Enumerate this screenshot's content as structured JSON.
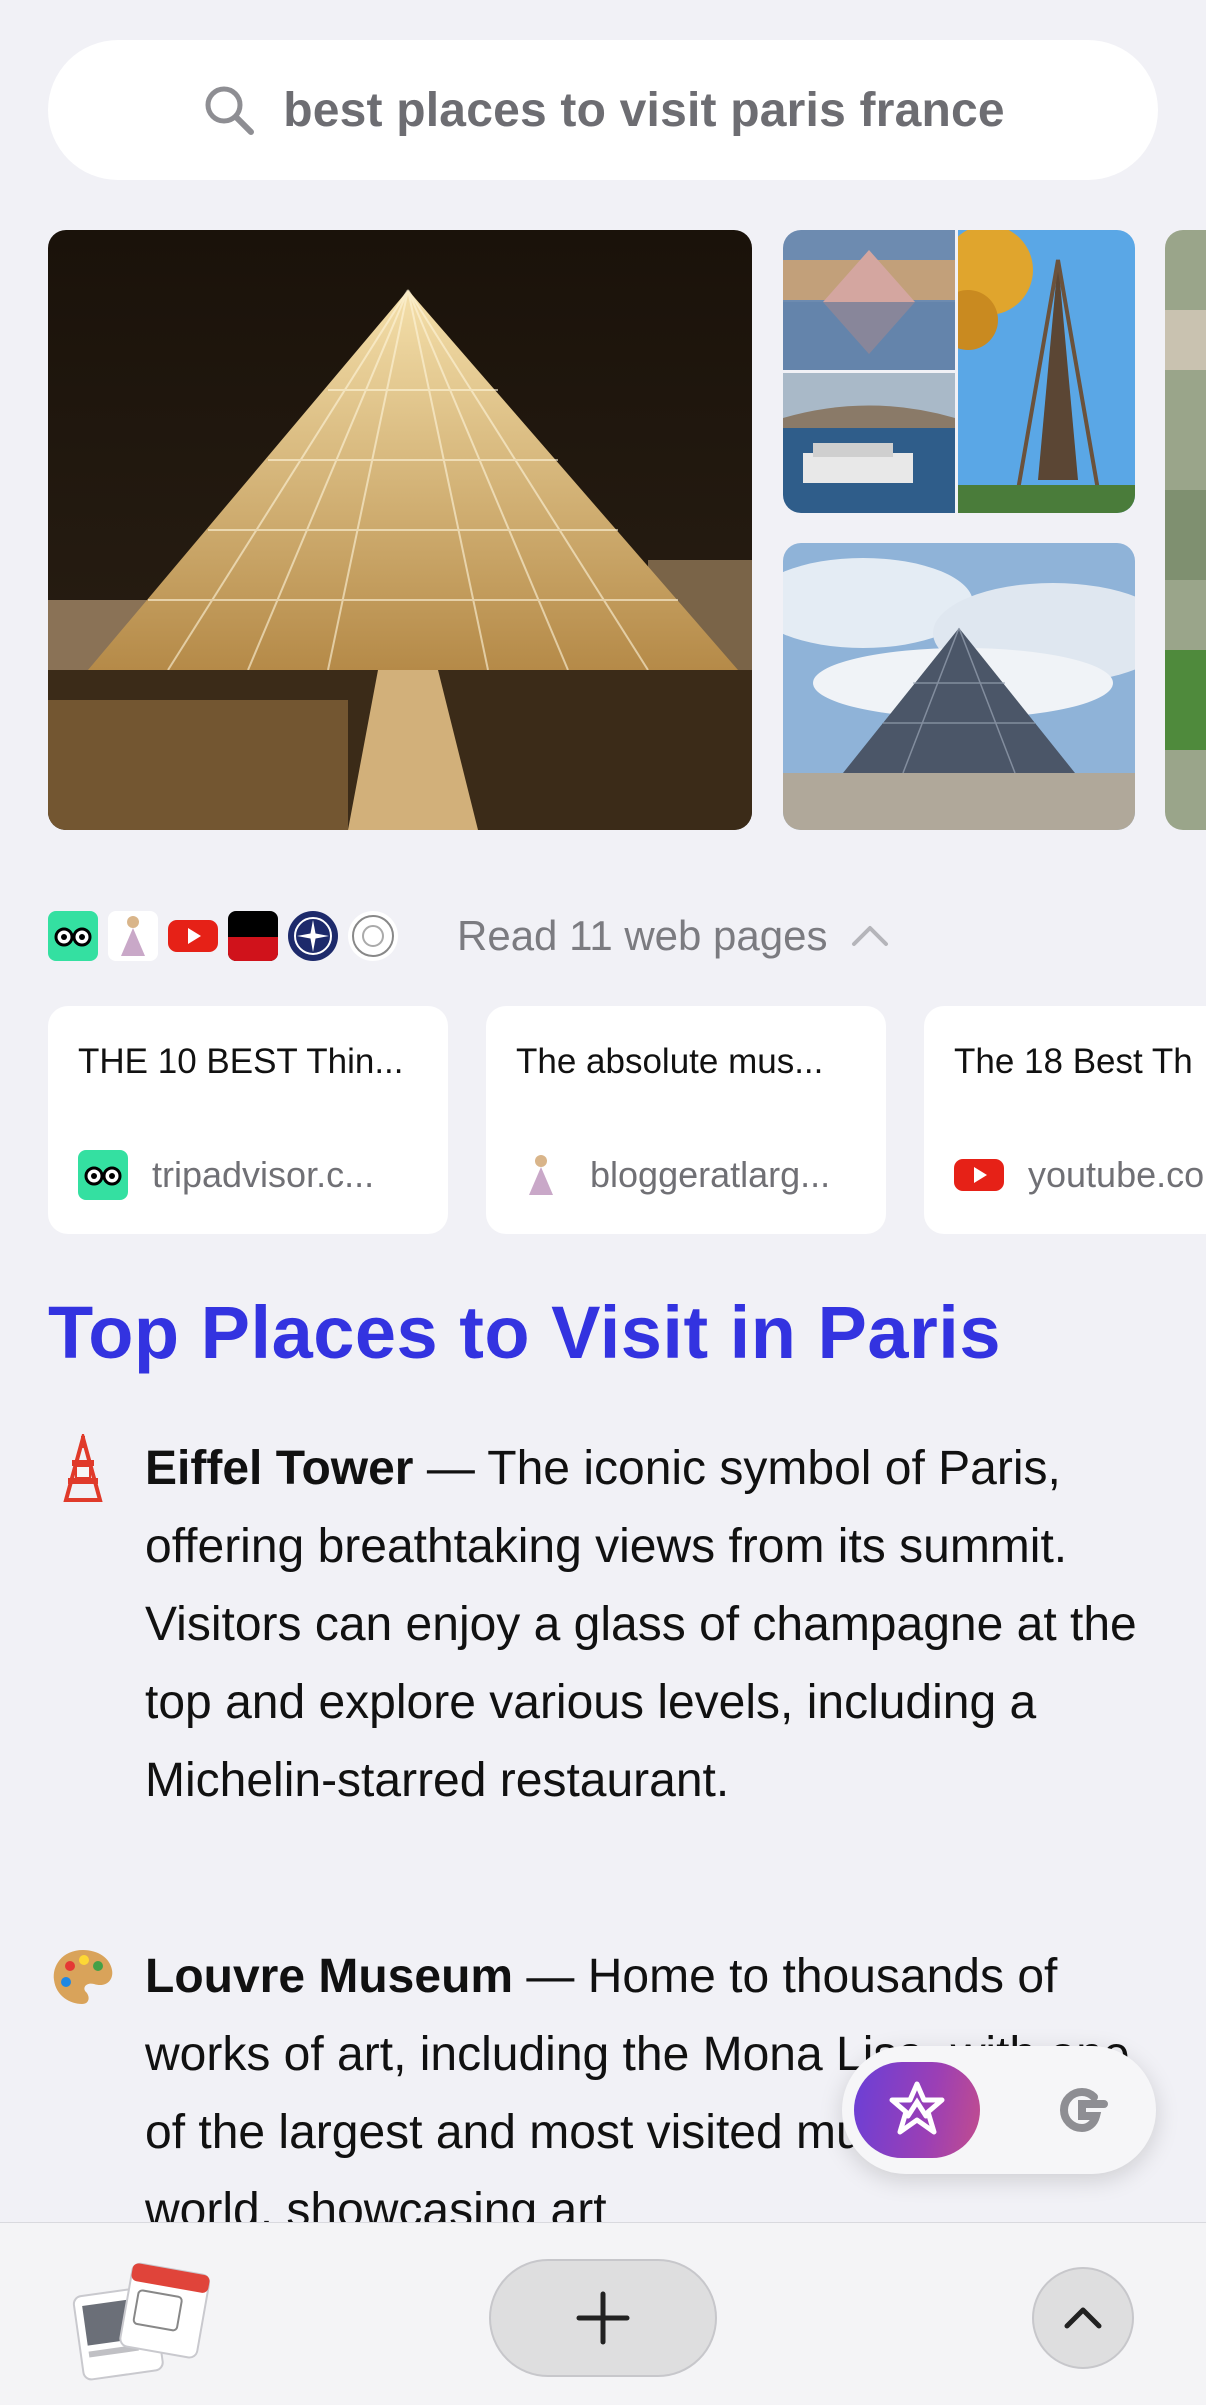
{
  "search": {
    "query": "best places to visit paris france",
    "icon": "search-icon"
  },
  "images": [
    {
      "label": "louvre-pyramid-night"
    },
    {
      "label": "louvre-reflection"
    },
    {
      "label": "eiffel-tower-autumn"
    },
    {
      "label": "seine-boat"
    },
    {
      "label": "louvre-pyramid-day"
    },
    {
      "label": "paris-aerial"
    }
  ],
  "sources": {
    "read_label": "Read 11 web pages",
    "icons": [
      "tripadvisor-icon",
      "bloggeratlarge-icon",
      "youtube-icon",
      "flag-icon",
      "compass-icon",
      "come-to-icon"
    ],
    "cards": [
      {
        "title": "THE 10 BEST Thin...",
        "site": "tripadvisor.c...",
        "icon": "tripadvisor-icon"
      },
      {
        "title": "The absolute mus...",
        "site": "bloggeratlarg...",
        "icon": "bloggeratlarge-icon"
      },
      {
        "title": "The 18 Best Th",
        "site": "youtube.co",
        "icon": "youtube-icon"
      }
    ]
  },
  "answer": {
    "heading": "Top Places to Visit in Paris",
    "items": [
      {
        "emoji": "tokyo-tower-icon",
        "name": "Eiffel Tower",
        "text": " — The iconic symbol of Paris, offering breathtaking views from its summit. Visitors can enjoy a glass of champagne at the top and explore various levels, including a Michelin-starred restaurant."
      },
      {
        "emoji": "artist-palette-icon",
        "name": "Louvre Museum",
        "text": " — Home to thousands of works of art, including the Mona Lisa, with one of the largest and most visited museums in the world, showcasing art"
      }
    ]
  },
  "floating": {
    "ai_button": "ai-assistant-icon",
    "google_button": "google-icon"
  },
  "bottom_bar": {
    "tabs": "tabs-thumbnail",
    "new_tab": "plus-icon",
    "scroll_up": "chevron-up-icon"
  },
  "colors": {
    "accent": "#3333e0",
    "background": "#f1f1f6"
  }
}
